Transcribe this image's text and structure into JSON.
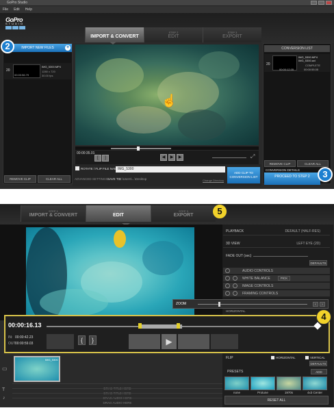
{
  "top": {
    "window_title": "GoPro Studio",
    "menu": [
      "File",
      "Edit",
      "Help"
    ],
    "logo_text": "GoPro",
    "logo_sub": "STUDIO",
    "steps": [
      {
        "num": "STEP 1",
        "label": "IMPORT & CONVERT"
      },
      {
        "num": "STEP 2",
        "label": "EDIT"
      },
      {
        "num": "STEP 3",
        "label": "EXPORT"
      }
    ],
    "import_label": "IMPORT NEW FILES",
    "file": {
      "num": "20",
      "name": "IMG_5300.MP4",
      "duration": "00:00:56.79",
      "res": "1280 x 720",
      "fps": "30.00 fps"
    },
    "remove_clip": "REMOVE CLIP",
    "clear_all": "CLEAR ALL",
    "timecode": "00:00:35.01",
    "rotate_label": "ROTATE / FLIP",
    "file_name_label": "FILE NAME:",
    "file_name_value": "IMG_5300",
    "save_to_label": "SAVE TO:",
    "save_to_value": "C:\\Users\\...\\Desktop",
    "advanced": "ADVANCED SETTINGS",
    "change_dir": "Change Directory",
    "add_clip": "ADD CLIP TO CONVERSION LIST",
    "conversion_list": "CONVERSION LIST",
    "conv_item": {
      "num": "20",
      "name1": "IMG_5300.MP4",
      "name2": "IMG_5300.avi",
      "tc1": "00:00:12.05",
      "tc2": "00:00:55.05",
      "status": "COMPLETE"
    },
    "conv_remove": "REMOVE CLIP",
    "conv_clear": "CLEAR ALL",
    "conv_details": "CONVERSION DETAILS",
    "proceed": "PROCEED TO STEP 2",
    "badge_2": "2",
    "badge_3": "3"
  },
  "bottom": {
    "steps": [
      {
        "num": "STEP 1",
        "label": "IMPORT & CONVERT"
      },
      {
        "num": "STEP 2",
        "label": "EDIT"
      },
      {
        "num": "STEP 3",
        "label": "EXPORT"
      }
    ],
    "badge_5": "5",
    "badge_4": "4",
    "playback": "PLAYBACK",
    "playback_val": "DEFAULT (HALF-RES)",
    "view3d": "3D VIEW",
    "view3d_val": "LEFT EYE (2D)",
    "fade_out": "FADE OUT (sec)",
    "defaults": "DEFAULTS",
    "controls": [
      "AUDIO CONTROLS",
      "WHITE BALANCE",
      "IMAGE CONTROLS",
      "FRAMING CONTROLS"
    ],
    "pick": "PICK",
    "zoom": "ZOOM",
    "horizontal_hdr": "HORIZONTAL",
    "timecode": "00:00:16.13",
    "in_label": "IN:",
    "in_tc": "00:00:42.23",
    "out_label": "OUT:",
    "out_tc": "00:00:59.03",
    "flip": "FLIP",
    "flip_h": "HORIZONTAL",
    "flip_v": "VERTICAL",
    "defaults2": "DEFAULTS",
    "presets": "PRESETS",
    "add": "ADD",
    "preset_names": [
      "none",
      "Protune",
      "1970s",
      "4x3 Center"
    ],
    "reset_all": "RESET ALL",
    "clip_name": "IMG_5300",
    "drag_title_1": "DRAG TITLE HERE",
    "drag_title_2": "DRAG TITLE HERE",
    "drag_audio": "DRAG AUDIO HERE",
    "drag_audio_2": "DRAG AUDIO HERE"
  },
  "colors": {
    "accent": "#1a70b8",
    "highlight": "#d9c44a"
  }
}
